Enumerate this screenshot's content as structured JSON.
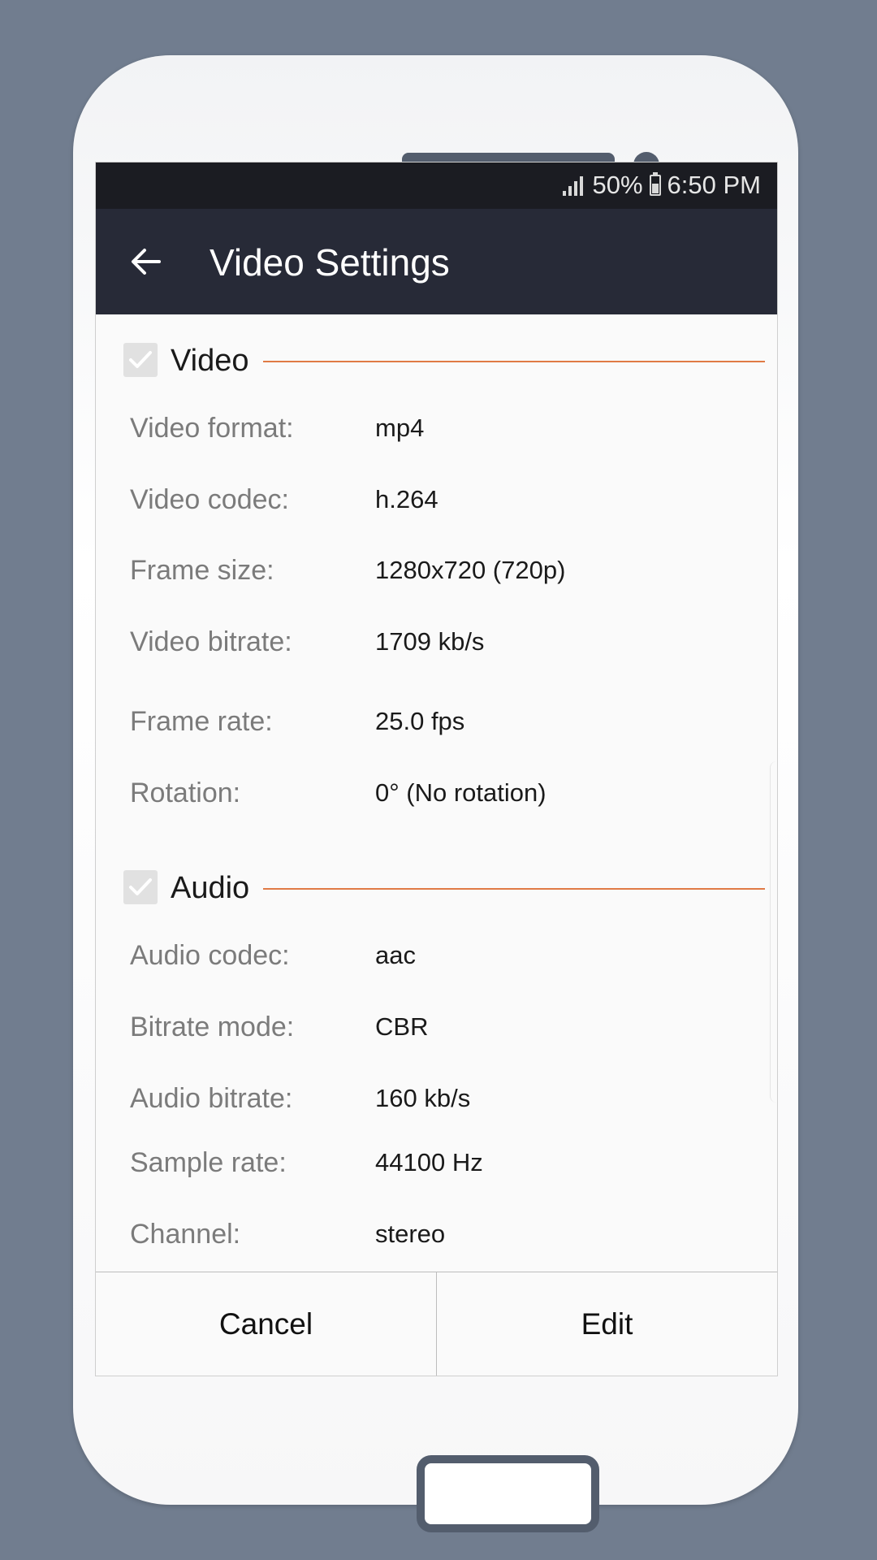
{
  "status_bar": {
    "battery": "50%",
    "time": "6:50 PM"
  },
  "app_bar": {
    "title": "Video Settings"
  },
  "sections": {
    "video": {
      "label": "Video",
      "checked": true,
      "rows": [
        {
          "key": "Video format:",
          "value": "mp4"
        },
        {
          "key": "Video codec:",
          "value": "h.264"
        },
        {
          "key": "Frame size:",
          "value": "1280x720 (720p)"
        },
        {
          "key": "Video bitrate:",
          "value": "1709 kb/s"
        },
        {
          "key": "Frame rate:",
          "value": "25.0 fps"
        },
        {
          "key": "Rotation:",
          "value": "0° (No rotation)"
        }
      ]
    },
    "audio": {
      "label": "Audio",
      "checked": true,
      "rows": [
        {
          "key": "Audio codec:",
          "value": "aac"
        },
        {
          "key": "Bitrate mode:",
          "value": "CBR"
        },
        {
          "key": "Audio bitrate:",
          "value": "160 kb/s"
        },
        {
          "key": "Sample rate:",
          "value": "44100 Hz"
        },
        {
          "key": "Channel:",
          "value": "stereo"
        }
      ]
    }
  },
  "buttons": {
    "cancel": "Cancel",
    "edit": "Edit"
  },
  "colors": {
    "accent_line": "#e07a45",
    "app_bar": "#272a37",
    "status_bar": "#1b1c22",
    "background": "#717d8f"
  }
}
